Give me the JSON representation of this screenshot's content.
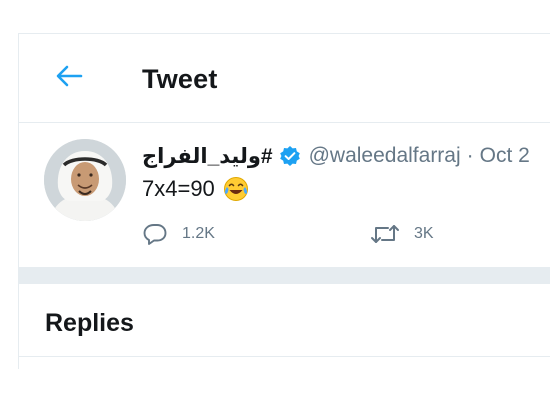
{
  "header": {
    "title": "Tweet",
    "back_icon": "arrow-left-icon"
  },
  "tweet": {
    "author": {
      "display_name": "#وليد_الفراج",
      "handle": "@waleedalfarraj",
      "verified": true
    },
    "separator": "·",
    "date": "Oct 2",
    "text": "7x4=90",
    "emoji_icon": "face-with-tears-of-joy-icon",
    "stats": {
      "replies": "1.2K",
      "retweets": "3K"
    }
  },
  "replies": {
    "heading": "Replies"
  },
  "colors": {
    "accent": "#1da1f2",
    "text_primary": "#14171a",
    "text_secondary": "#657786",
    "divider": "#e6ecf0"
  }
}
